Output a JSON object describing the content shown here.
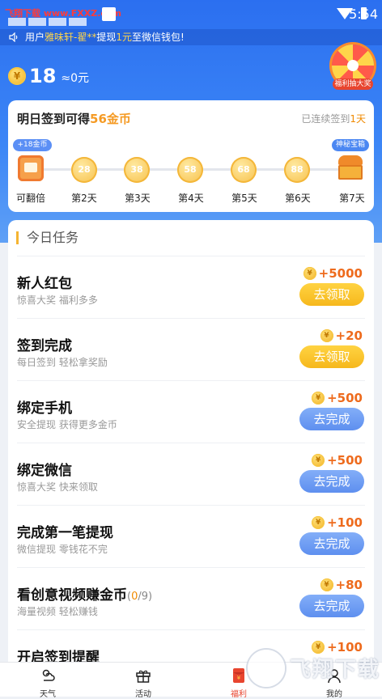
{
  "status_bar": {
    "watermark": "飞翔下载 www.FXXZ.com",
    "time": "5:54"
  },
  "notice": {
    "prefix": "用户",
    "user": "雅味轩-翟**",
    "mid": "提现",
    "amount": "1元",
    "suffix": "至微信钱包!"
  },
  "wallet": {
    "coin_symbol": "¥",
    "coins": "18",
    "equals": "≈0元"
  },
  "lucky_wheel": {
    "label": "福利抽大奖"
  },
  "sign_card": {
    "title_prefix": "明日签到可得",
    "title_reward": "56金币",
    "streak_prefix": "已连续签到",
    "streak_days": "1天",
    "bubble_first": "+18金币",
    "bubble_last": "神秘宝箱",
    "days": [
      {
        "label": "可翻倍",
        "value": ""
      },
      {
        "label": "第2天",
        "value": "28"
      },
      {
        "label": "第3天",
        "value": "38"
      },
      {
        "label": "第4天",
        "value": "58"
      },
      {
        "label": "第5天",
        "value": "68"
      },
      {
        "label": "第6天",
        "value": "88"
      },
      {
        "label": "第7天",
        "value": ""
      }
    ]
  },
  "tasks": {
    "header": "今日任务",
    "items": [
      {
        "name": "新人红包",
        "progress": "",
        "desc": "惊喜大奖 福利多多",
        "reward": "+5000",
        "button": "去领取"
      },
      {
        "name": "签到完成",
        "progress": "",
        "desc": "每日签到 轻松拿奖励",
        "reward": "+20",
        "button": "去领取"
      },
      {
        "name": "绑定手机",
        "progress": "",
        "desc": "安全提现 获得更多金币",
        "reward": "+500",
        "button": "去完成"
      },
      {
        "name": "绑定微信",
        "progress": "",
        "desc": "惊喜大奖 快来领取",
        "reward": "+500",
        "button": "去完成"
      },
      {
        "name": "完成第一笔提现",
        "progress": "",
        "desc": "微信提现 零钱花不完",
        "reward": "+100",
        "button": "去完成"
      },
      {
        "name": "看创意视频赚金币",
        "progress_open": "(",
        "progress_done": "0",
        "progress_rest": "/9)",
        "desc": "海量视频 轻松赚钱",
        "reward": "+80",
        "button": "去完成"
      },
      {
        "name": "开启签到提醒",
        "progress": "",
        "desc": "",
        "reward": "+100",
        "button": ""
      }
    ]
  },
  "tabbar": {
    "items": [
      {
        "label": "天气",
        "icon": "weather-icon"
      },
      {
        "label": "活动",
        "icon": "gift-icon"
      },
      {
        "label": "福利",
        "icon": "red-envelope-icon"
      },
      {
        "label": "我的",
        "icon": "profile-icon"
      }
    ],
    "active": "福利"
  },
  "overlay_watermark": {
    "text": "飞翔下载"
  },
  "colors": {
    "primary_blue": "#3c86f6",
    "gold": "#f6b81c",
    "reward_orange": "#ee6b1d",
    "active_tab": "#e8452f"
  }
}
